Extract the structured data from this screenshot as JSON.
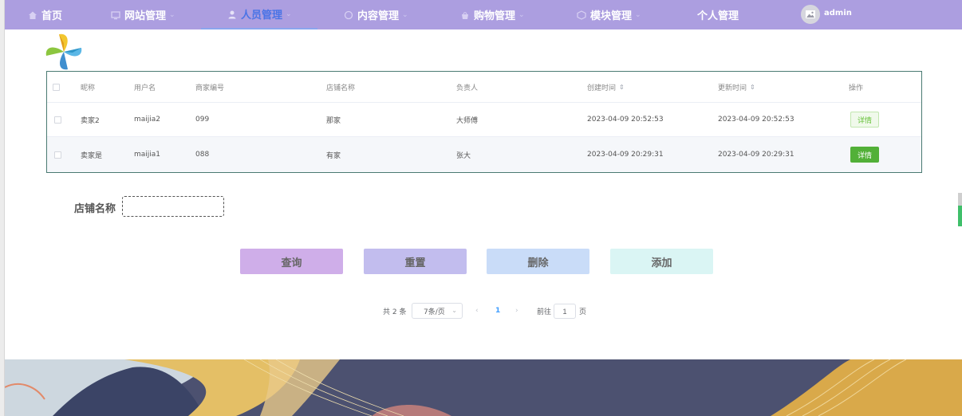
{
  "nav": {
    "items": [
      {
        "label": "首页",
        "icon": "home-icon",
        "active": false,
        "has_caret": false
      },
      {
        "label": "网站管理",
        "icon": "monitor-icon",
        "active": false,
        "has_caret": true
      },
      {
        "label": "人员管理",
        "icon": "user-icon",
        "active": true,
        "has_caret": true
      },
      {
        "label": "内容管理",
        "icon": "chat-icon",
        "active": false,
        "has_caret": true
      },
      {
        "label": "购物管理",
        "icon": "basket-icon",
        "active": false,
        "has_caret": true
      },
      {
        "label": "模块管理",
        "icon": "cube-icon",
        "active": false,
        "has_caret": true
      },
      {
        "label": "个人管理",
        "icon": "",
        "active": false,
        "has_caret": false
      }
    ],
    "user_name": "admin"
  },
  "table": {
    "headers": [
      "昵称",
      "用户名",
      "商家编号",
      "店铺名称",
      "负责人",
      "创建时间",
      "更新时间",
      "操作"
    ],
    "rows": [
      {
        "nickname": "卖家2",
        "username": "maijia2",
        "merchant_no": "099",
        "shop_name": "那家",
        "manager": "大师傅",
        "created": "2023-04-09 20:52:53",
        "updated": "2023-04-09 20:52:53",
        "action": "详情"
      },
      {
        "nickname": "卖家是",
        "username": "maijia1",
        "merchant_no": "088",
        "shop_name": "有家",
        "manager": "张大",
        "created": "2023-04-09 20:29:31",
        "updated": "2023-04-09 20:29:31",
        "action": "详情"
      }
    ]
  },
  "search": {
    "label": "店铺名称",
    "value": ""
  },
  "actions": {
    "query": "查询",
    "reset": "重置",
    "delete": "删除",
    "add": "添加"
  },
  "pagination": {
    "total": "共 2 条",
    "page_size": "7条/页",
    "current_page": "1",
    "goto_prefix": "前往",
    "goto_value": "1",
    "goto_suffix": "页"
  },
  "colors": {
    "nav_bg": "#ac9ee0",
    "nav_active": "#4a74e6",
    "btn_query": "#cfaee9",
    "btn_reset": "#c2bdee",
    "btn_delete": "#c9dcf8",
    "btn_add": "#daf5f4",
    "detail_green": "#52b038"
  }
}
